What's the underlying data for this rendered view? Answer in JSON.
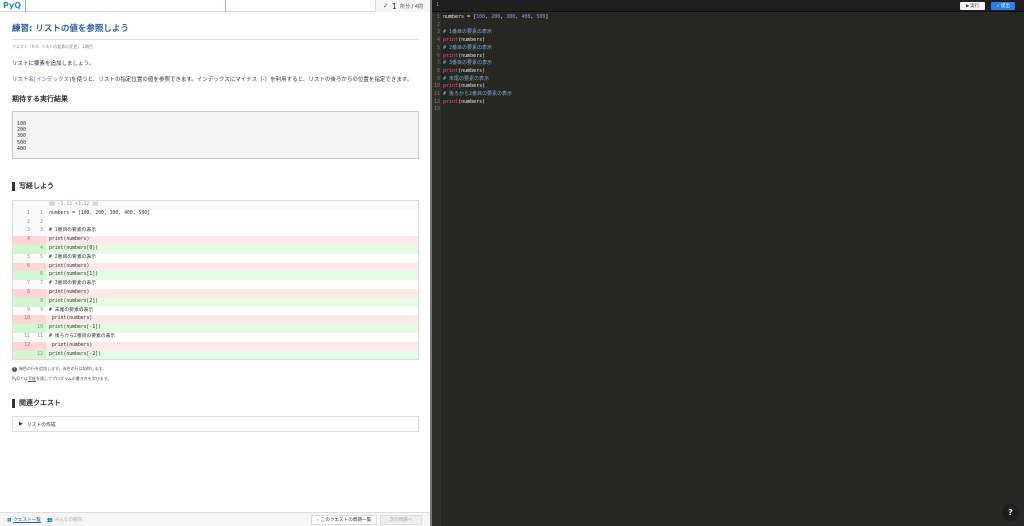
{
  "topbar": {
    "logo": "PyQ",
    "progress_count": "1",
    "progress_text": "所分 / 4問"
  },
  "quest": {
    "title": "練習: リストの値を参照しよう",
    "breadcrumb": "クエスト「6-0. リストの要素の変更」 1問目",
    "p1": "リストに要素を追加しましょう。",
    "p2_highlight": "リスト名[インデックス]",
    "p2_rest": "を使うと、リストの指定位置の値を参照できます。インデックスにマイナス（-）を利用すると、リストの後ろからの位置を指定できます。",
    "expected_heading": "期待する実行結果",
    "expected_output": [
      "100",
      "200",
      "300",
      "500",
      "400"
    ],
    "copy_heading": "写経しよう",
    "diff_hunk": "@@ -1,12 +1,12 @@",
    "diff_lines": [
      {
        "type": "ctx",
        "old": "1",
        "new": "1",
        "code": "numbers = [100, 200, 300, 400, 500]"
      },
      {
        "type": "ctx",
        "old": "2",
        "new": "2",
        "code": ""
      },
      {
        "type": "ctx",
        "old": "3",
        "new": "3",
        "code": "# 1番目の要素の表示"
      },
      {
        "type": "del",
        "old": "4",
        "new": "",
        "code": "print(numbers)"
      },
      {
        "type": "add",
        "old": "",
        "new": "4",
        "code": "print(numbers[0])"
      },
      {
        "type": "ctx",
        "old": "5",
        "new": "5",
        "code": "# 2番目の要素の表示"
      },
      {
        "type": "del",
        "old": "6",
        "new": "",
        "code": "print(numbers)"
      },
      {
        "type": "add",
        "old": "",
        "new": "6",
        "code": "print(numbers[1])"
      },
      {
        "type": "ctx",
        "old": "7",
        "new": "7",
        "code": "# 3番目の要素の表示"
      },
      {
        "type": "del",
        "old": "8",
        "new": "",
        "code": "print(numbers)"
      },
      {
        "type": "add",
        "old": "",
        "new": "8",
        "code": "print(numbers[2])"
      },
      {
        "type": "ctx",
        "old": "9",
        "new": "9",
        "code": "# 末尾の要素の表示"
      },
      {
        "type": "del",
        "old": "10",
        "new": "",
        "code": " print(numbers)"
      },
      {
        "type": "add",
        "old": "",
        "new": "10",
        "code": "print(numbers[-1])"
      },
      {
        "type": "ctx",
        "old": "11",
        "new": "11",
        "code": "# 後ろから2番目の要素の表示"
      },
      {
        "type": "del",
        "old": "12",
        "new": "",
        "code": " print(numbers)"
      },
      {
        "type": "add",
        "old": "",
        "new": "12",
        "code": "print(numbers[-2])"
      }
    ],
    "note1": "緑色の行を追加します。赤色の行は削除します。",
    "note2_pre": "PyQでは",
    "note2_link": "写経",
    "note2_post": "を通してプログラムの書き方を学びます。",
    "related_heading": "関連クエスト",
    "related_item": "リストの作成"
  },
  "bottombar": {
    "quest_list": "クエスト一覧",
    "answers": "みんなの解答",
    "problems": "このクエストの問題一覧",
    "next": "次の問題へ"
  },
  "editor": {
    "file_indicator": "1",
    "run_label": "実行",
    "submit_label": "提出",
    "lines": [
      "numbers = [100, 200, 300, 400, 500]",
      "",
      "# 1番目の要素の表示",
      "print(numbers)",
      "# 2番目の要素の表示",
      "print(numbers)",
      "# 3番目の要素の表示",
      "print(numbers)",
      "# 末尾の要素の表示",
      "print(numbers)",
      "# 後ろから2番目の要素の表示",
      "print(numbers)",
      ""
    ]
  },
  "help": "?",
  "colors": {
    "accent": "#2b7de9",
    "title": "#2c5fa5",
    "editor_bg": "#272822"
  }
}
